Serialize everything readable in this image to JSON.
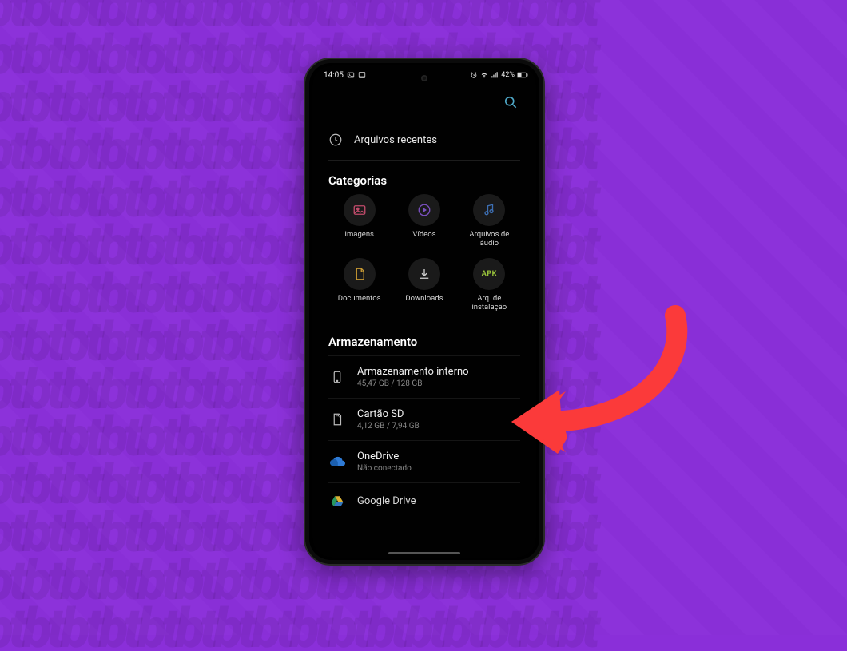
{
  "status": {
    "time": "14:05",
    "battery": "42%"
  },
  "recent": {
    "label": "Arquivos recentes"
  },
  "categories": {
    "title": "Categorias",
    "items": [
      {
        "label": "Imagens",
        "icon": "images-icon"
      },
      {
        "label": "Vídeos",
        "icon": "videos-icon"
      },
      {
        "label": "Arquivos de áudio",
        "icon": "audio-icon"
      },
      {
        "label": "Documentos",
        "icon": "documents-icon"
      },
      {
        "label": "Downloads",
        "icon": "downloads-icon"
      },
      {
        "label": "Arq. de instalação",
        "icon": "apk-icon"
      }
    ]
  },
  "storage": {
    "title": "Armazenamento",
    "items": [
      {
        "title": "Armazenamento interno",
        "sub": "45,47 GB / 128 GB",
        "icon": "phone-icon"
      },
      {
        "title": "Cartão SD",
        "sub": "4,12 GB / 7,94 GB",
        "icon": "sd-icon"
      },
      {
        "title": "OneDrive",
        "sub": "Não conectado",
        "icon": "onedrive-icon"
      },
      {
        "title": "Google Drive",
        "sub": "",
        "icon": "gdrive-icon"
      }
    ]
  },
  "colors": {
    "accent": "#4fa9c9",
    "arrow": "#fb3a3a",
    "imagesIcon": "#c14b6b",
    "videosIcon": "#7a4fc0",
    "audioIcon": "#3d6fb3",
    "docsIcon": "#c99a33",
    "dlIcon": "#cfcfcf",
    "apkIcon": "#9ac33b",
    "onedrive": "#2f7bd6"
  }
}
